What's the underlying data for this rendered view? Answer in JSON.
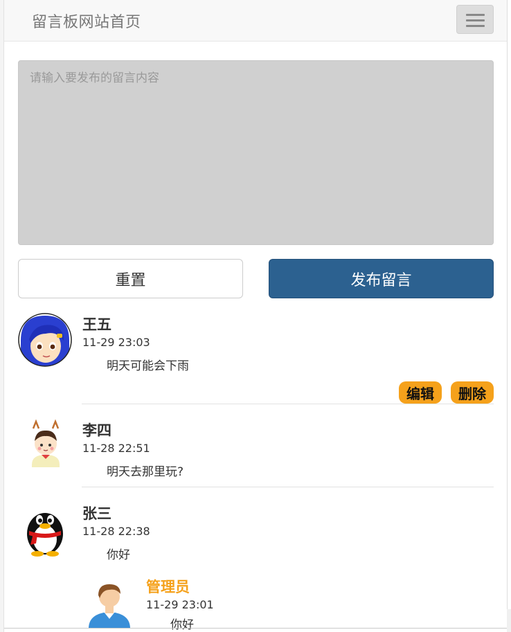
{
  "navbar": {
    "brand": "留言板网站首页",
    "menu_icon": "hamburger-menu-icon"
  },
  "compose": {
    "placeholder": "请输入要发布的留言内容",
    "value": ""
  },
  "buttons": {
    "reset_label": "重置",
    "post_label": "发布留言"
  },
  "comments": [
    {
      "name": "王五",
      "time": "11-29 23:03",
      "text": "明天可能会下雨",
      "avatar": "anime-girl-avatar",
      "actions": {
        "edit_label": "编辑",
        "delete_label": "删除"
      }
    },
    {
      "name": "李四",
      "time": "11-28 22:51",
      "text": "明天去那里玩?",
      "avatar": "cartoon-kid-avatar"
    },
    {
      "name": "张三",
      "time": "11-28 22:38",
      "text": "你好",
      "avatar": "penguin-avatar",
      "reply": {
        "name": "管理员",
        "time": "11-29 23:01",
        "text": "你好",
        "avatar": "admin-person-avatar"
      }
    }
  ],
  "colors": {
    "accent_orange": "#f5a11b",
    "primary_blue": "#2c6190",
    "textarea_gray": "#d0d0d0"
  }
}
